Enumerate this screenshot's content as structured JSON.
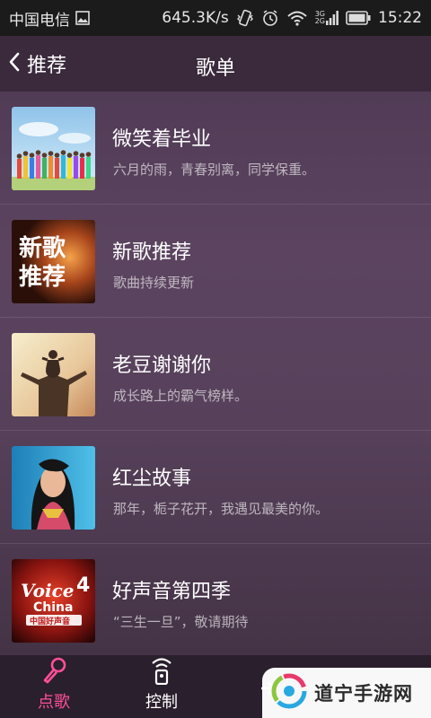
{
  "status_bar": {
    "carrier": "中国电信",
    "net_speed": "645.3K/s",
    "network_type_top": "3G",
    "network_type_bottom": "2G",
    "time": "15:22"
  },
  "nav": {
    "back_label": "推荐",
    "title": "歌单"
  },
  "playlists": [
    {
      "title": "微笑着毕业",
      "subtitle": "六月的雨，青春别离，同学保重。",
      "cover_text": ""
    },
    {
      "title": "新歌推荐",
      "subtitle": "歌曲持续更新",
      "cover_text_line1": "新歌",
      "cover_text_line2": "推荐"
    },
    {
      "title": "老豆谢谢你",
      "subtitle": "成长路上的霸气榜样。"
    },
    {
      "title": "红尘故事",
      "subtitle": "那年，栀子花开，我遇见最美的你。"
    },
    {
      "title": "好声音第四季",
      "subtitle": "“三生一旦”，敬请期待",
      "cover_logo_text_1": "Voice",
      "cover_logo_text_2": "China",
      "cover_logo_num": "4",
      "cover_logo_cn": "中国好声音"
    }
  ],
  "tabs": [
    {
      "label": "点歌",
      "icon": "microphone-icon",
      "active": true
    },
    {
      "label": "控制",
      "icon": "remote-icon",
      "active": false
    },
    {
      "label": "",
      "icon": "share-icon",
      "active": false
    },
    {
      "label": "",
      "icon": "user-icon",
      "active": false
    }
  ],
  "watermark": {
    "text": "道宁手游网"
  },
  "colors": {
    "accent": "#ff4f9a",
    "background": "#4a3650",
    "status_bar": "#1b1b1b"
  }
}
